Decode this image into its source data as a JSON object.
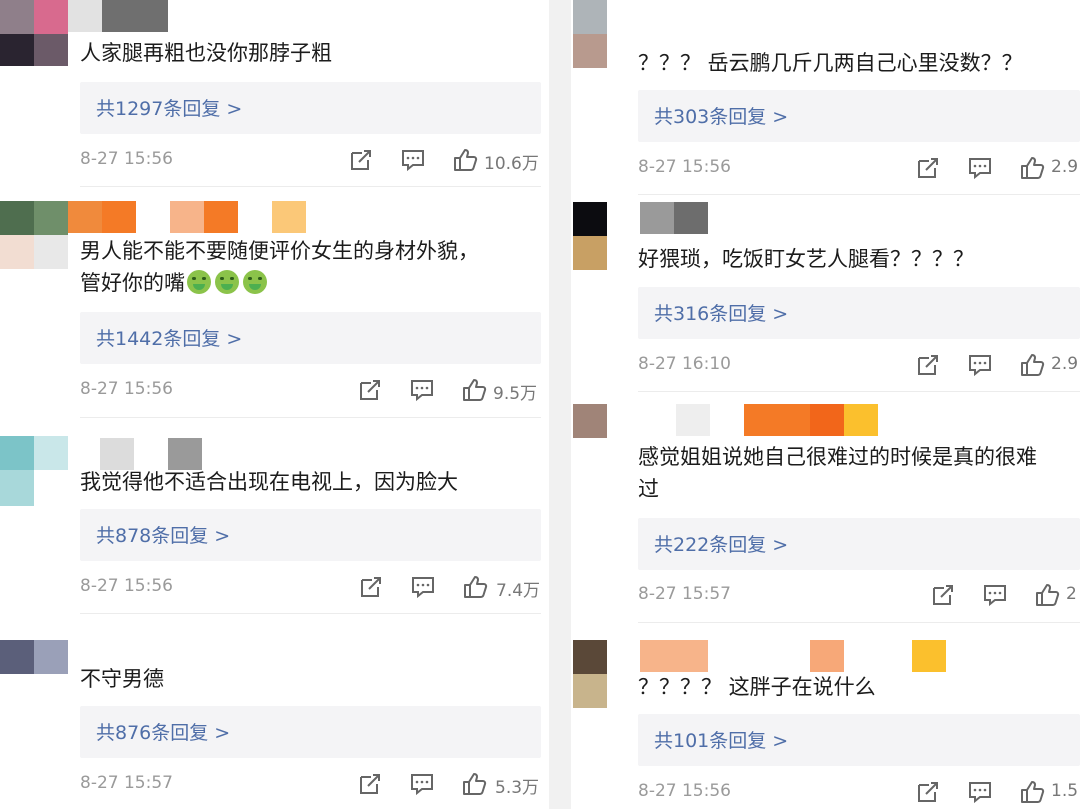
{
  "left_comments": [
    {
      "text": "人家腿再粗也没你那脖子粗",
      "reply_label": "共1297条回复 >",
      "time": "8-27 15:56",
      "likes": "10.6万"
    },
    {
      "text": "男人能不能不要随便评价女生的身材外貌，",
      "text2": "管好你的嘴",
      "reply_label": "共1442条回复 >",
      "time": "8-27 15:56",
      "likes": "9.5万"
    },
    {
      "text": "我觉得他不适合出现在电视上，因为脸大",
      "reply_label": "共878条回复 >",
      "time": "8-27 15:56",
      "likes": "7.4万"
    },
    {
      "text": "不守男德",
      "reply_label": "共876条回复 >",
      "time": "8-27 15:57",
      "likes": "5.3万"
    }
  ],
  "right_comments": [
    {
      "text": "？？？ 岳云鹏几斤几两自己心里没数？？",
      "reply_label": "共303条回复 >",
      "time": "8-27 15:56",
      "likes": "2.9"
    },
    {
      "text": "好猥琐，吃饭盯女艺人腿看？？？？",
      "reply_label": "共316条回复 >",
      "time": "8-27 16:10",
      "likes": "2.9"
    },
    {
      "text": "感觉姐姐说她自己很难过的时候是真的很难",
      "text2": "过",
      "reply_label": "共222条回复 >",
      "time": "8-27 15:57",
      "likes": "2"
    },
    {
      "text": "？？？？ 这胖子在说什么",
      "reply_label": "共101条回复 >",
      "time": "8-27 15:56",
      "likes": "1.5"
    }
  ],
  "icons": [
    "repost-icon",
    "comment-icon",
    "like-icon"
  ],
  "colors": {
    "reply_text": "#4f6ea8",
    "reply_bg": "#f4f4f6",
    "meta_text": "#9a9a9a"
  }
}
